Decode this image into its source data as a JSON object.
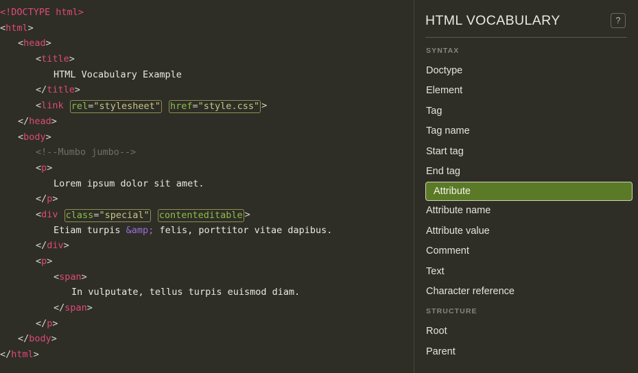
{
  "theme": {
    "background": "#2e2e26",
    "text": "#e6e6df",
    "tag_color": "#e0497b",
    "attr_name_color": "#8ebf4a",
    "attr_value_color": "#c8c488",
    "comment_color": "#6f7264",
    "entity_color": "#9a6ee0",
    "highlight_bg": "#5b7a27",
    "highlight_border": "#cfd4b3",
    "attr_box_border": "#8e8f54",
    "divider": "#5a5a50"
  },
  "code": {
    "lines": [
      {
        "indent": 0,
        "tokens": [
          {
            "t": "doctype",
            "v": "<!DOCTYPE html>"
          }
        ]
      },
      {
        "indent": 0,
        "tokens": [
          {
            "t": "punct",
            "v": "<"
          },
          {
            "t": "tagname",
            "v": "html"
          },
          {
            "t": "punct",
            "v": ">"
          }
        ]
      },
      {
        "indent": 1,
        "tokens": [
          {
            "t": "punct",
            "v": "<"
          },
          {
            "t": "tagname",
            "v": "head"
          },
          {
            "t": "punct",
            "v": ">"
          }
        ]
      },
      {
        "indent": 2,
        "tokens": [
          {
            "t": "punct",
            "v": "<"
          },
          {
            "t": "tagname",
            "v": "title"
          },
          {
            "t": "punct",
            "v": ">"
          }
        ]
      },
      {
        "indent": 3,
        "tokens": [
          {
            "t": "txt",
            "v": "HTML Vocabulary Example"
          }
        ]
      },
      {
        "indent": 2,
        "tokens": [
          {
            "t": "punct",
            "v": "</"
          },
          {
            "t": "tagname",
            "v": "title"
          },
          {
            "t": "punct",
            "v": ">"
          }
        ]
      },
      {
        "indent": 2,
        "tokens": [
          {
            "t": "punct",
            "v": "<"
          },
          {
            "t": "tagname",
            "v": "link"
          },
          {
            "t": "space",
            "v": " "
          },
          {
            "t": "attr",
            "name": "rel",
            "eq": "=",
            "value": "\"stylesheet\""
          },
          {
            "t": "space",
            "v": " "
          },
          {
            "t": "attr",
            "name": "href",
            "eq": "=",
            "value": "\"style.css\""
          },
          {
            "t": "punct",
            "v": ">"
          }
        ]
      },
      {
        "indent": 1,
        "tokens": [
          {
            "t": "punct",
            "v": "</"
          },
          {
            "t": "tagname",
            "v": "head"
          },
          {
            "t": "punct",
            "v": ">"
          }
        ]
      },
      {
        "indent": 1,
        "tokens": [
          {
            "t": "punct",
            "v": "<"
          },
          {
            "t": "tagname",
            "v": "body"
          },
          {
            "t": "punct",
            "v": ">"
          }
        ]
      },
      {
        "indent": 2,
        "tokens": [
          {
            "t": "comment",
            "v": "<!--Mumbo jumbo-->"
          }
        ]
      },
      {
        "indent": 2,
        "tokens": [
          {
            "t": "punct",
            "v": "<"
          },
          {
            "t": "tagname",
            "v": "p"
          },
          {
            "t": "punct",
            "v": ">"
          }
        ]
      },
      {
        "indent": 3,
        "tokens": [
          {
            "t": "txt",
            "v": "Lorem ipsum dolor sit amet."
          }
        ]
      },
      {
        "indent": 2,
        "tokens": [
          {
            "t": "punct",
            "v": "</"
          },
          {
            "t": "tagname",
            "v": "p"
          },
          {
            "t": "punct",
            "v": ">"
          }
        ]
      },
      {
        "indent": 2,
        "tokens": [
          {
            "t": "punct",
            "v": "<"
          },
          {
            "t": "tagname",
            "v": "div"
          },
          {
            "t": "space",
            "v": " "
          },
          {
            "t": "attr",
            "name": "class",
            "eq": "=",
            "value": "\"special\""
          },
          {
            "t": "space",
            "v": " "
          },
          {
            "t": "attr",
            "name": "contenteditable",
            "eq": "",
            "value": ""
          },
          {
            "t": "punct",
            "v": ">"
          }
        ]
      },
      {
        "indent": 3,
        "tokens": [
          {
            "t": "txt",
            "v": "Etiam turpis "
          },
          {
            "t": "entity",
            "v": "&amp;"
          },
          {
            "t": "txt",
            "v": " felis, porttitor vitae dapibus."
          }
        ]
      },
      {
        "indent": 2,
        "tokens": [
          {
            "t": "punct",
            "v": "</"
          },
          {
            "t": "tagname",
            "v": "div"
          },
          {
            "t": "punct",
            "v": ">"
          }
        ]
      },
      {
        "indent": 2,
        "tokens": [
          {
            "t": "punct",
            "v": "<"
          },
          {
            "t": "tagname",
            "v": "p"
          },
          {
            "t": "punct",
            "v": ">"
          }
        ]
      },
      {
        "indent": 3,
        "tokens": [
          {
            "t": "punct",
            "v": "<"
          },
          {
            "t": "tagname",
            "v": "span"
          },
          {
            "t": "punct",
            "v": ">"
          }
        ]
      },
      {
        "indent": 4,
        "tokens": [
          {
            "t": "txt",
            "v": "In vulputate, tellus turpis euismod diam."
          }
        ]
      },
      {
        "indent": 3,
        "tokens": [
          {
            "t": "punct",
            "v": "</"
          },
          {
            "t": "tagname",
            "v": "span"
          },
          {
            "t": "punct",
            "v": ">"
          }
        ]
      },
      {
        "indent": 2,
        "tokens": [
          {
            "t": "punct",
            "v": "</"
          },
          {
            "t": "tagname",
            "v": "p"
          },
          {
            "t": "punct",
            "v": ">"
          }
        ]
      },
      {
        "indent": 1,
        "tokens": [
          {
            "t": "punct",
            "v": "</"
          },
          {
            "t": "tagname",
            "v": "body"
          },
          {
            "t": "punct",
            "v": ">"
          }
        ]
      },
      {
        "indent": 0,
        "tokens": [
          {
            "t": "punct",
            "v": "</"
          },
          {
            "t": "tagname",
            "v": "html"
          },
          {
            "t": "punct",
            "v": ">"
          }
        ]
      }
    ]
  },
  "sidebar": {
    "title": "HTML VOCABULARY",
    "help_label": "?",
    "groups": [
      {
        "section": "SYNTAX",
        "items": [
          {
            "label": "Doctype",
            "active": false
          },
          {
            "label": "Element",
            "active": false
          },
          {
            "label": "Tag",
            "active": false
          },
          {
            "label": "Tag name",
            "active": false
          },
          {
            "label": "Start tag",
            "active": false
          },
          {
            "label": "End tag",
            "active": false
          },
          {
            "label": "Attribute",
            "active": true
          },
          {
            "label": "Attribute name",
            "active": false
          },
          {
            "label": "Attribute value",
            "active": false
          },
          {
            "label": "Comment",
            "active": false
          },
          {
            "label": "Text",
            "active": false
          },
          {
            "label": "Character reference",
            "active": false
          }
        ]
      },
      {
        "section": "STRUCTURE",
        "items": [
          {
            "label": "Root",
            "active": false
          },
          {
            "label": "Parent",
            "active": false
          }
        ]
      }
    ]
  }
}
